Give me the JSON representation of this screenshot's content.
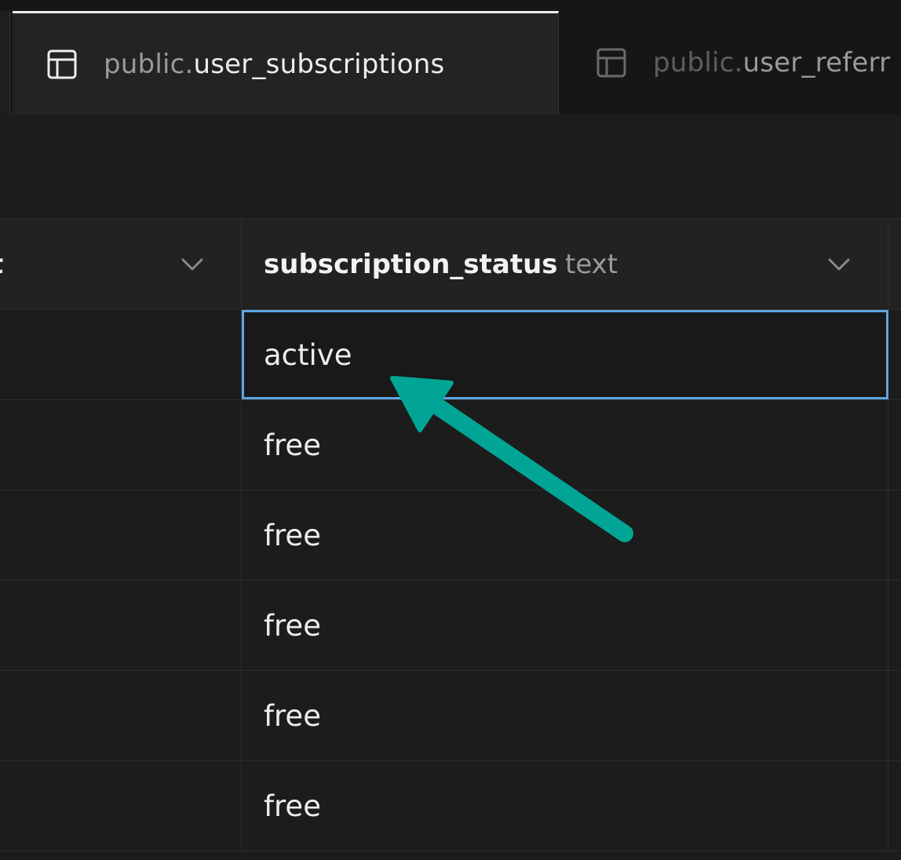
{
  "tabs": [
    {
      "schema": "public.",
      "table": "user_subscriptions",
      "active": true,
      "icon": "table-icon"
    },
    {
      "schema": "public.",
      "table": "user_referr",
      "active": false,
      "icon": "table-icon"
    }
  ],
  "grid": {
    "left_column": {
      "label_fragment": "t",
      "icon": "chevron-down-icon"
    },
    "column": {
      "name": "subscription_status",
      "type": "text",
      "icon": "chevron-down-icon"
    },
    "rows": [
      "active",
      "free",
      "free",
      "free",
      "free",
      "free"
    ],
    "selected_row": 0
  },
  "colors": {
    "selection_border": "#5fa4e0",
    "annotation_arrow": "#00a596"
  }
}
